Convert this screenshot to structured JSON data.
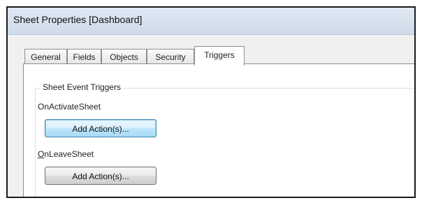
{
  "window": {
    "title": "Sheet Properties [Dashboard]"
  },
  "tabs": [
    {
      "label": "General"
    },
    {
      "label": "Fields"
    },
    {
      "label": "Objects"
    },
    {
      "label": "Security"
    },
    {
      "label": "Triggers",
      "selected": true
    }
  ],
  "group": {
    "title": "Sheet Event Triggers",
    "triggers": [
      {
        "label": "OnActivateSheet",
        "button": "Add Action(s)..."
      },
      {
        "label_mnemonic": "O",
        "label_rest": "nLeaveSheet",
        "button": "Add Action(s)..."
      }
    ]
  },
  "colors": {
    "titlebar": "#cfdbe9",
    "dialog_bg": "#f0f0f0",
    "page_bg": "#ffffff",
    "focus_border": "#3c7fb1"
  }
}
